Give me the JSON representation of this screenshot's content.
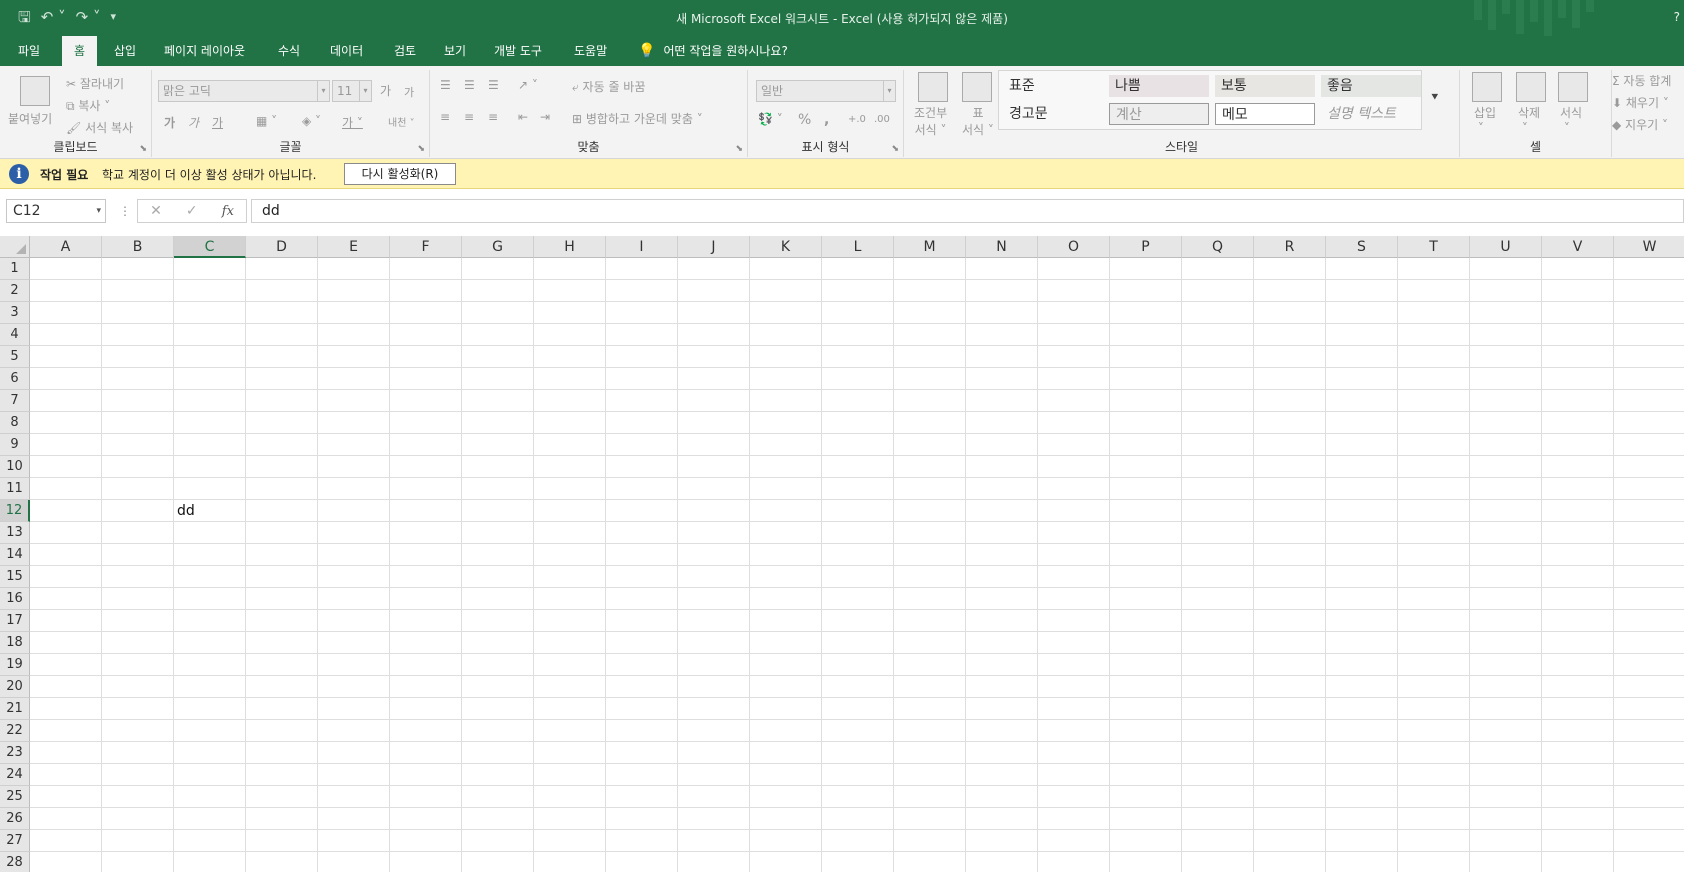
{
  "window": {
    "title": "새 Microsoft Excel 워크시트  -  Excel (사용 허가되지 않은 제품)",
    "help": "?"
  },
  "qat": {
    "save_icon": "save-icon",
    "undo_icon": "undo-icon",
    "redo_icon": "redo-icon",
    "customize_icon": "customize-icon"
  },
  "tabs": [
    {
      "label": "파일"
    },
    {
      "label": "홈"
    },
    {
      "label": "삽입"
    },
    {
      "label": "페이지 레이아웃"
    },
    {
      "label": "수식"
    },
    {
      "label": "데이터"
    },
    {
      "label": "검토"
    },
    {
      "label": "보기"
    },
    {
      "label": "개발 도구"
    },
    {
      "label": "도움말"
    }
  ],
  "active_tab": "홈",
  "tell_me": "어떤 작업을 원하시나요?",
  "ribbon": {
    "clipboard": {
      "label": "클립보드",
      "paste": "붙여넣기",
      "cut": "잘라내기",
      "copy": "복사",
      "format_painter": "서식 복사"
    },
    "font": {
      "label": "글꼴",
      "font_name": "맑은 고딕",
      "font_size": "11",
      "grow": "가",
      "shrink": "가",
      "bold": "가",
      "italic": "가",
      "underline": "가",
      "font_color": "가",
      "phonetic": "내천"
    },
    "alignment": {
      "label": "맞춤",
      "wrap_text": "자동 줄 바꿈",
      "merge_center": "병합하고 가운데 맞춤"
    },
    "number": {
      "label": "표시 형식",
      "format": "일반",
      "percent": "%",
      "comma": ",",
      "inc_decimal": "+.0",
      "dec_decimal": ".00"
    },
    "styles": {
      "label": "스타일",
      "conditional_line1": "조건부",
      "conditional_line2": "서식",
      "table_line1": "표",
      "table_line2": "서식",
      "cells": [
        {
          "label": "표준",
          "bg": "#f3f3f3"
        },
        {
          "label": "나쁨",
          "bg": "#e8e2e4"
        },
        {
          "label": "보통",
          "bg": "#e8e6e2"
        },
        {
          "label": "좋음",
          "bg": "#e4e6e4"
        },
        {
          "label": "경고문",
          "bg": "#f3f3f3"
        },
        {
          "label": "계산",
          "bg": "#eeeeee"
        },
        {
          "label": "메모",
          "bg": "#ffffff"
        },
        {
          "label": "설명 텍스트",
          "bg": "#f3f3f3"
        }
      ]
    },
    "cells": {
      "label": "셀",
      "insert": "삽입",
      "delete": "삭제",
      "format": "서식"
    },
    "editing": {
      "autosum": "자동 합계",
      "fill": "채우기",
      "clear": "지우기"
    }
  },
  "message_bar": {
    "title": "작업 필요",
    "text": "학교 계정이 더 이상 활성 상태가 아닙니다.",
    "button": "다시 활성화(R)"
  },
  "formula_bar": {
    "name_box": "C12",
    "cancel": "✕",
    "enter": "✓",
    "fx": "fx",
    "content": "dd"
  },
  "sheet": {
    "columns": [
      "A",
      "B",
      "C",
      "D",
      "E",
      "F",
      "G",
      "H",
      "I",
      "J",
      "K",
      "L",
      "M",
      "N",
      "O",
      "P",
      "Q",
      "R",
      "S",
      "T",
      "U",
      "V",
      "W"
    ],
    "rows": [
      "1",
      "2",
      "3",
      "4",
      "5",
      "6",
      "7",
      "8",
      "9",
      "10",
      "11",
      "12",
      "13",
      "14",
      "15",
      "16",
      "17",
      "18",
      "19",
      "20",
      "21",
      "22",
      "23",
      "24",
      "25",
      "26",
      "27",
      "28"
    ],
    "selected_column": "C",
    "selected_row": "12",
    "cell_values": [
      {
        "ref": "C12",
        "col": 2,
        "row": 11,
        "value": "dd"
      }
    ]
  }
}
